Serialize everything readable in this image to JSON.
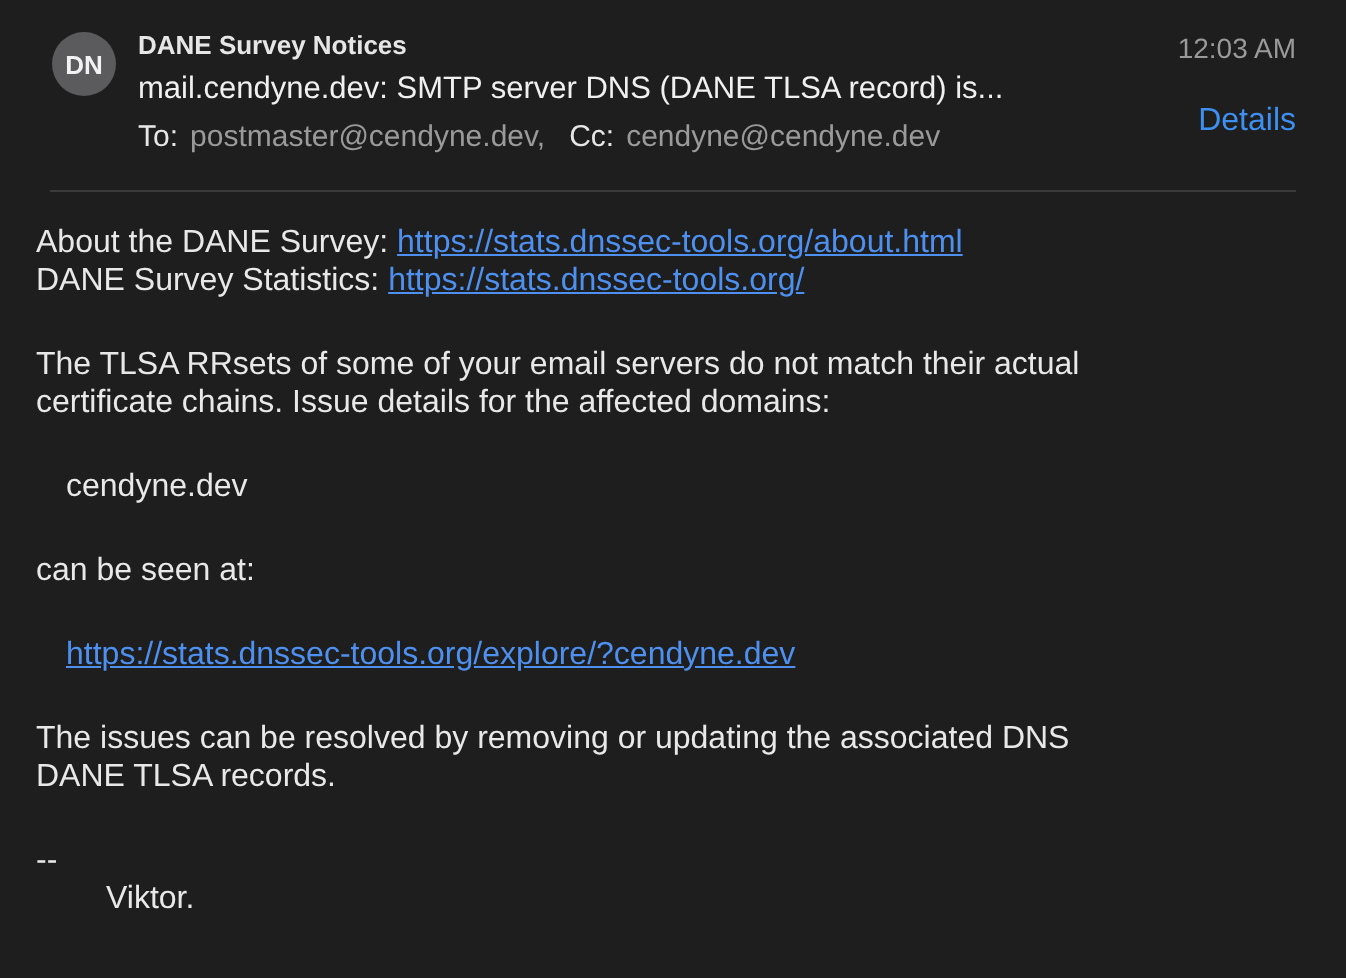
{
  "header": {
    "avatar": "DN",
    "sender": "DANE Survey Notices",
    "subject": "mail.cendyne.dev: SMTP server DNS (DANE TLSA record) is...",
    "time": "12:03 AM",
    "details": "Details",
    "to_label": "To:",
    "to": "postmaster@cendyne.dev,",
    "cc_label": "Cc:",
    "cc": "cendyne@cendyne.dev"
  },
  "body": [
    {
      "kind": "labeled_links",
      "lines": [
        {
          "label": "About the DANE Survey: ",
          "link": "https://stats.dnssec-tools.org/about.html"
        },
        {
          "label": "DANE Survey Statistics:",
          "link": "https://stats.dnssec-tools.org/"
        }
      ]
    },
    {
      "kind": "paragraph",
      "lines": [
        "The TLSA RRsets of some of your email servers do not match their actual",
        "certificate chains.  Issue details for the affected domains:"
      ]
    },
    {
      "kind": "indented",
      "text": "cendyne.dev"
    },
    {
      "kind": "paragraph",
      "lines": [
        "can be seen at:"
      ]
    },
    {
      "kind": "link",
      "text": "https://stats.dnssec-tools.org/explore/?cendyne.dev"
    },
    {
      "kind": "paragraph",
      "lines": [
        "The issues can be resolved by removing or updating the associated DNS",
        "DANE TLSA records."
      ]
    },
    {
      "kind": "signature",
      "dashes": "--",
      "name": "Viktor."
    }
  ]
}
